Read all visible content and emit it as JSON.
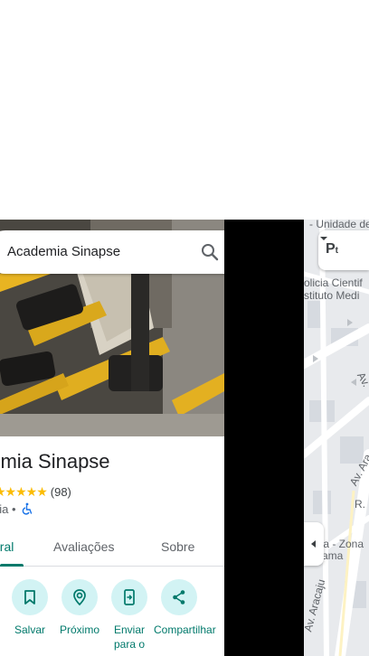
{
  "search": {
    "query": "Academia Sinapse"
  },
  "place": {
    "name": "demia Sinapse",
    "stars": "★★★★★",
    "review_count": "(98)",
    "category": "nia •"
  },
  "tabs": [
    {
      "label": "eral"
    },
    {
      "label": "Avaliações"
    },
    {
      "label": "Sobre"
    }
  ],
  "actions": [
    {
      "label": "Salvar",
      "icon": "bookmark-icon"
    },
    {
      "label": "Próximo",
      "icon": "nearby-icon"
    },
    {
      "label": "Enviar para o",
      "icon": "send-to-phone-icon"
    },
    {
      "label": "Compartilhar",
      "icon": "share-icon"
    }
  ],
  "map": {
    "labels": [
      "- Unidade de",
      "olicia Cientif",
      "stituto Medi",
      "Av.",
      "Av. Ara",
      "R.",
      "ta - Zona",
      "ama",
      "Av. Aracaju"
    ]
  },
  "colors": {
    "accent": "#00796b",
    "action_circle": "#d2f3f4",
    "star": "#fbbc04",
    "map_background": "#e8eaed"
  }
}
